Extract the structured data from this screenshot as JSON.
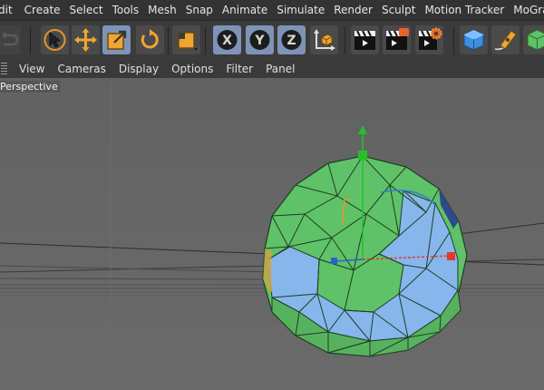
{
  "menu": {
    "items": [
      "dit",
      "Create",
      "Select",
      "Tools",
      "Mesh",
      "Snap",
      "Animate",
      "Simulate",
      "Render",
      "Sculpt",
      "Motion Tracker",
      "MoGraph"
    ]
  },
  "toolbar": {
    "tools": [
      {
        "name": "undo-icon",
        "active": false
      },
      {
        "name": "select-arrow-icon",
        "active": false
      },
      {
        "name": "move-icon",
        "active": false
      },
      {
        "name": "scale-icon",
        "active": true
      },
      {
        "name": "rotate-icon",
        "active": false
      },
      {
        "name": "recent-tools-icon",
        "active": false
      },
      {
        "name": "x-axis-lock-icon",
        "active": true
      },
      {
        "name": "y-axis-lock-icon",
        "active": true
      },
      {
        "name": "z-axis-lock-icon",
        "active": true
      },
      {
        "name": "coordinate-system-icon",
        "active": false
      },
      {
        "name": "render-view-icon",
        "active": false
      },
      {
        "name": "render-picture-viewer-icon",
        "active": false
      },
      {
        "name": "render-settings-icon",
        "active": false
      },
      {
        "name": "cube-object-icon",
        "active": false
      },
      {
        "name": "spline-pen-icon",
        "active": false
      },
      {
        "name": "generator-icon",
        "active": false
      }
    ],
    "axis_labels": {
      "x": "X",
      "y": "Y",
      "z": "Z"
    }
  },
  "viewport_menu": {
    "items": [
      "View",
      "Cameras",
      "Display",
      "Options",
      "Filter",
      "Panel"
    ]
  },
  "viewport": {
    "camera_label": "Perspective",
    "colors": {
      "sphere_green": "#5fc268",
      "selected_faces_blue": "#86b6ec",
      "axis_x": "#e33b2b",
      "axis_y": "#23c02c",
      "axis_z": "#2f5fd0",
      "scale_handle": "#e8962a"
    }
  }
}
